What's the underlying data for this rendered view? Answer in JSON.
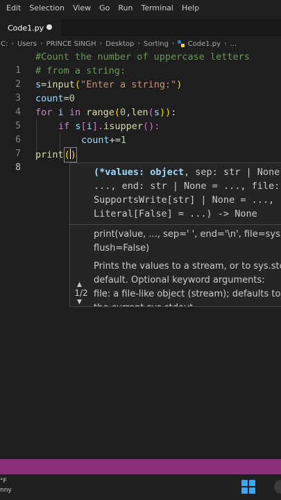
{
  "menu": [
    "Edit",
    "Selection",
    "View",
    "Go",
    "Run",
    "Terminal",
    "Help"
  ],
  "tab": {
    "label": "Code1.py"
  },
  "breadcrumb": [
    "C:",
    "Users",
    "PRINCE SINGH",
    "Desktop",
    "Sorting",
    "Code1.py",
    "..."
  ],
  "line_numbers": [
    "1",
    "2",
    "3",
    "4",
    "5",
    "6",
    "7",
    "8"
  ],
  "code": {
    "l1": "#Count the number of uppercase letters",
    "l2": "# from a string:",
    "l3": {
      "a": "s",
      "b": "=",
      "c": "input",
      "d": "(",
      "e": "\"Enter a string:\"",
      "f": ")"
    },
    "l4": {
      "a": "count",
      "b": "=",
      "c": "0"
    },
    "l5": {
      "a": "for",
      "b": "i",
      "c": "in",
      "d": "range",
      "e": "(",
      "f": "0",
      "g": ",",
      "h": "len",
      "i": "(",
      "j": "s",
      "k": "))",
      "l": ":"
    },
    "l6": {
      "a": "if",
      "b": "s",
      "c": "[",
      "d": "i",
      "e": "].",
      "f": "isupper",
      "g": "():"
    },
    "l7": {
      "a": "count",
      "b": "+=",
      "c": "1"
    },
    "l8": {
      "a": "print",
      "b": "(",
      "c": ")"
    }
  },
  "hover": {
    "sig1_hl": "(*values: object",
    "sig1_rest": ", sep: str | None",
    "sig2": "..., end: str | None = ..., file:",
    "sig3": "SupportsWrite[str] | None = ...,",
    "sig4": "Literal[False] = ...) -> None",
    "doc1": "print(value, ..., sep=' ', end='\\n', file=sys.s",
    "doc2": "flush=False)",
    "doc3": "Prints the values to a stream, or to sys.stc",
    "doc4": "default. Optional keyword arguments:",
    "doc5": "file: a file-like object (stream); defaults to",
    "doc6": "the current sys.stdout.",
    "pager": "1/2"
  },
  "taskbar": {
    "line1": "°F",
    "line2": "nny"
  },
  "colors": {
    "status_bar": "#8b2f7a",
    "accent": "#3ba7f5"
  }
}
